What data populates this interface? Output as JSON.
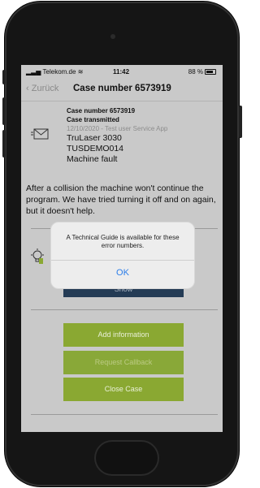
{
  "status_bar": {
    "carrier": "Telekom.de",
    "time": "11:42",
    "battery": "88 %"
  },
  "nav": {
    "back_label": "Zurück",
    "title": "Case number 6573919"
  },
  "case": {
    "number_label": "Case number 6573919",
    "status": "Case transmitted",
    "date_app": "12/10/2020 - Test user Service App",
    "machine": "TruLaser 3030",
    "serial": "TUSDEMO014",
    "fault": "Machine fault",
    "description": "After a collision the machine won't continue the program. We have tried turning it off and on again, but it doesn't help."
  },
  "guide": {
    "show_label": "Show"
  },
  "actions": {
    "add_information": "Add information",
    "request_callback": "Request Callback",
    "close_case": "Close Case"
  },
  "dialog": {
    "message": "A Technical Guide is available for these error numbers.",
    "ok_label": "OK"
  },
  "colors": {
    "action_green": "#8aa832",
    "show_navy": "#243b55",
    "ios_blue": "#2b7de9",
    "overlay_gray": "#c9c9c9"
  }
}
